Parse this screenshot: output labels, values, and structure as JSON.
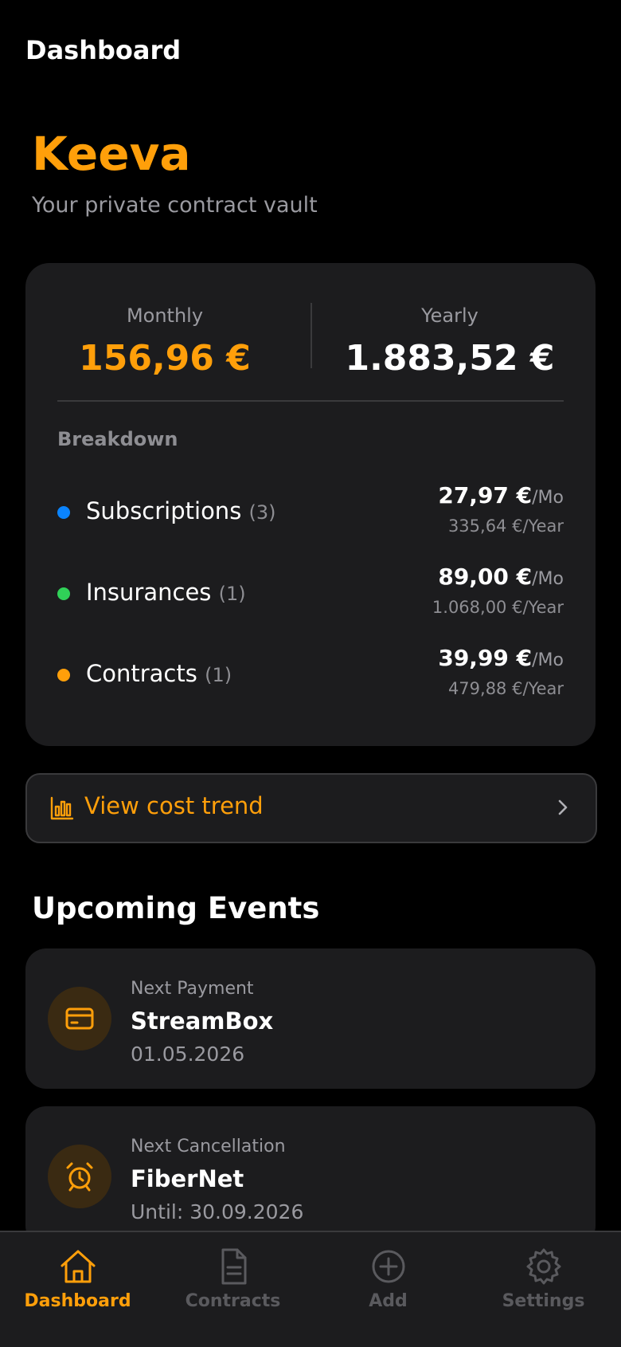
{
  "header": {
    "title": "Dashboard"
  },
  "brand": {
    "name": "Keeva",
    "tagline": "Your private contract vault"
  },
  "summary": {
    "monthly_label": "Monthly",
    "monthly_value": "156,96 €",
    "yearly_label": "Yearly",
    "yearly_value": "1.883,52 €",
    "breakdown_title": "Breakdown",
    "items": [
      {
        "label": "Subscriptions",
        "count": "(3)",
        "monthly": "27,97 €",
        "monthly_unit": "/Mo",
        "yearly": "335,64 €/Year",
        "color": "#0a84ff"
      },
      {
        "label": "Insurances",
        "count": "(1)",
        "monthly": "89,00 €",
        "monthly_unit": "/Mo",
        "yearly": "1.068,00 €/Year",
        "color": "#30d158"
      },
      {
        "label": "Contracts",
        "count": "(1)",
        "monthly": "39,99 €",
        "monthly_unit": "/Mo",
        "yearly": "479,88 €/Year",
        "color": "#ff9f0a"
      }
    ]
  },
  "trend": {
    "label": "View cost trend",
    "icon": "bar-chart-icon"
  },
  "events": {
    "title": "Upcoming Events",
    "items": [
      {
        "kind": "Next Payment",
        "name": "StreamBox",
        "date": "01.05.2026",
        "icon": "credit-card-icon"
      },
      {
        "kind": "Next Cancellation",
        "name": "FiberNet",
        "date": "Until: 30.09.2026",
        "icon": "alarm-clock-icon"
      }
    ]
  },
  "tabs": [
    {
      "label": "Dashboard",
      "icon": "home-icon",
      "active": true
    },
    {
      "label": "Contracts",
      "icon": "document-icon",
      "active": false
    },
    {
      "label": "Add",
      "icon": "plus-circle-icon",
      "active": false
    },
    {
      "label": "Settings",
      "icon": "gear-icon",
      "active": false
    }
  ],
  "colors": {
    "accent": "#ff9f0a",
    "background": "#000000",
    "card": "#1c1c1e",
    "muted_text": "#9a9aa0",
    "inactive_tab": "#5a5a5e"
  }
}
